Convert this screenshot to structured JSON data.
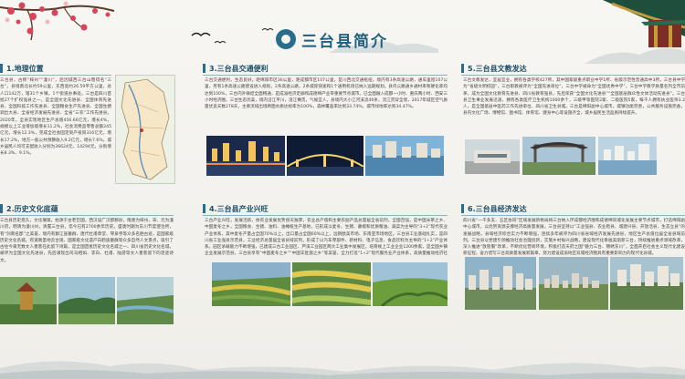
{
  "title": "三台县简介",
  "sections": {
    "geo": {
      "heading": "1.地理位置",
      "text": "三台县，古称“梓州”“潼川”，后因城西三台山而得名“三台”。县境南北长约59公里，东西宽约26.59平方公里，总人口142万，辖31个乡镇，1个街道办事处。三台是四川首批27个扩权强县之一，是全国文化先进县、全国体育先进县、全国科技工作先进县、全国粮食生产先进县、全国生猪调出大县、全省经济发展先进县、全省“三农”工作先进县。2020年，全县实现地区生产总值456.66亿元，增长4%，规模以上工业增加值增长11.2%，社会消费品零售总额245亿元，增长12.3%，完成全社会固定资产投资316亿元，增长17.2%，地方一般公共预算收入9.2亿元，增长7.6%，城乡居民人均可支配收入分别为36624元、14294元，分别增长8.3%、9.1%。"
    },
    "culture": {
      "heading": "2.历史文化底蕴",
      "text": "三台县历史悠久，文化璀璨，始源于古老巴国，西汉设广汉郡郪县，隋唐为梓州，宋、元为潼川府，明清为潼川州，清置三台县，迄今已有2700余年历史。盛唐时期为东川节度使治所，有“剑南名郡”之美誉，境内有郪江崖墓群、唐代杜甫草堂、琴泉寺等众多名胜古迹，是国家级历史文化名城。有道教圣地云台观、国家级文化遗产白鹤崖墓群等众多自然人文景点，吸引了古往今来无数文人墨客在此留下诗篇，是全国首批历史文化名城之一、四川省历史文化名城，被评为全国文化先进县，先后涌现出司马相如、李白、杜甫、陆游等文人墨客留下的足迹诗文。"
    },
    "traffic": {
      "heading": "3.三台县交通便利",
      "text": "三台交通便利，生态良好。距绵阳市区36公里，距成都市区107公里，是川西北交通枢纽。境内有3条高速公路，通车里程107公里，另有1条高速公路建设进入规划，2条高速公路，2条城际快速和1个通用机场已纳入远期规划。县内公路通乡通村率和硬化率均达到100%，三台内外联结全面畅通，是成渝经济走廊和成德绵产业带重要节点城市。已全面融入成都一小时、重庆两小时、西安三小时经济圈。三台生态优美，境内沿江平川，涪江横贯，气候宜人，县境内大小江河溪流46条，流江贯穿全境，2017年城区空气质量优良天数278天，主要流域出境断面水质达标率为100%，森林覆盖率达到33.74%，城市绿地率达到34.47%。"
    },
    "industry": {
      "heading": "4.三台县产业兴旺",
      "text": "三台产业兴旺，发展活跃，依农业发展优势傍天独厚，农业总产值和主要农副产品总量居全省前列，全国百强，是中国米茶之乡、中国麦冬之乡，全国粮食、生猪、油料、油橄榄生产基地，已形成以麦冬、生猪、藤椒和优质粮油、蔬菜为主导的“3+2”现代农业产业体系，其中麦冬产量占全国70%以上，出口量占全国60%以上，远销欧美市场、东南亚市场地区。三台县工业基础扎实，是四川省工业强县示范县，工业经济总量居全省县域前列，形成了以汽车零部件、新材料、电子信息、食品饮料为主导的“1+2”产业体系。园区承载能力不断增强，已建成三台工业园区、芦溪工业园区两大工业集中发展区，培育规上工业企业1200余家，是全国乡镇企业发展示范县。三台县享有“中国麦冬之乡”“中国羊肚菌之乡”等美誉，全力打造“1+2”现代服务业产业体系，高质量推动经济社会发展。"
    },
    "tourism": {
      "heading": "5.三台县文教发达",
      "text": "三台文教发达，宜居宜业，拥有各类学校427所，其中国家级重点职业中学1所、省级示范性普通高中3所，三台县中学为“省级文明校园”，三台职教被评为“全国先进单位”，三台中学被命为“全国优秀中学”，三台中学教学质量名列全市前茅，成为全国文化教育先进县、四川省教育强县，先后荣获“全国文化先进县”“全国基层群众性文体活动先进县”。三台县卫生事业发展迅速，拥有各类医疗卫生机构1000余个，三级甲等医院2家、二级医院5家，每千人拥有执业医师3.2人，是全国基层中医药工作先进单位、四川省卫生县城。三台是绵阳副中心城市，城镇功能完善，公共服务设施完备，县内文化广场、博物馆、图书馆、体育馆、健身中心等设施齐全，城乡居民生活品质持续提升。"
    },
    "economy": {
      "heading": "6.三台县经济发达",
      "text": "四川省“一干多支、五区协同”区域发展新格局将三台纳入环成都经济圈和成德绵同城化发展主要节点城市，打造绵阳副中心城市，以优势资源支撑经济高质量发展。三台县坚持以“工业强县、农业稳县、城建兴县、开放活县、生态立县”的发展战略，县域经济综合实力不断增强，连续多年被评为四川省县域经济发展先进县，地区生产总值位居全省县域前列。三台县以党建引领推动社会治理创新，实施乡村振兴战略，建设现代化幸福美丽新三台，持续推进重点领域改革，深入推进“放管服”改革，不断优化营商环境，积极打造天府之国“魅力三台、锦绣东川”，全面开启社会主义现代化建设新征程，奋力谱写三台高质量发展新篇章，努力建设成渝地区双城经济圈具有重要影响力的现代化县城。"
    }
  }
}
